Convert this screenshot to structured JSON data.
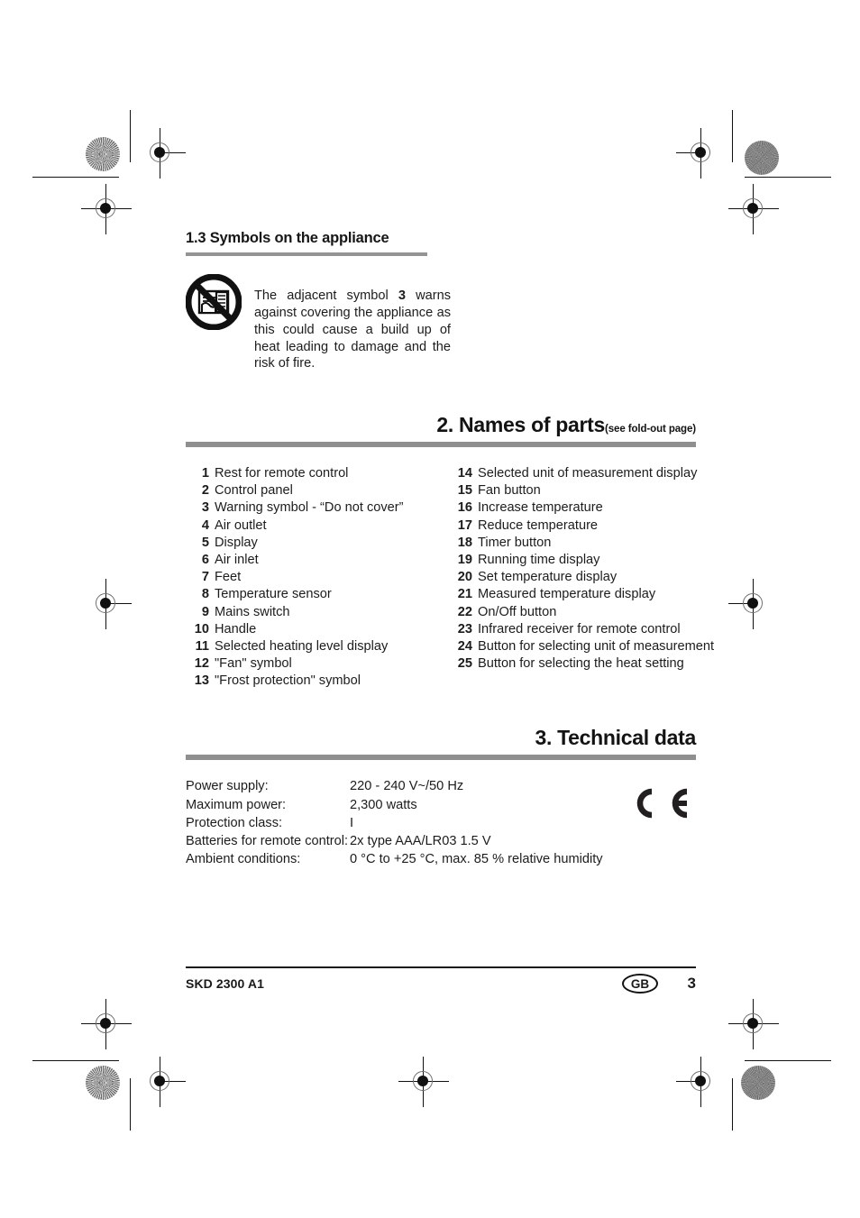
{
  "section_symbols": {
    "heading": "1.3 Symbols on the appliance",
    "icon": "do-not-cover-prohibition-icon",
    "paragraph_pre": "The adjacent symbol ",
    "paragraph_bold": "3",
    "paragraph_post": " warns against covering the appliance as this could cause a build up of heat leading to damage and the risk of fire."
  },
  "section_parts": {
    "heading": "2. Names of parts",
    "heading_note": "(see fold-out page)",
    "left_column": [
      {
        "num": "1",
        "label": "Rest for remote control"
      },
      {
        "num": "2",
        "label": "Control panel"
      },
      {
        "num": "3",
        "label": "Warning symbol - “Do not cover”"
      },
      {
        "num": "4",
        "label": "Air outlet"
      },
      {
        "num": "5",
        "label": "Display"
      },
      {
        "num": "6",
        "label": "Air inlet"
      },
      {
        "num": "7",
        "label": "Feet"
      },
      {
        "num": "8",
        "label": "Temperature sensor"
      },
      {
        "num": "9",
        "label": "Mains switch"
      },
      {
        "num": "10",
        "label": "Handle"
      },
      {
        "num": "11",
        "label": "Selected heating level display"
      },
      {
        "num": "12",
        "label": "\"Fan\" symbol"
      },
      {
        "num": "13",
        "label": "\"Frost protection\" symbol"
      }
    ],
    "right_column": [
      {
        "num": "14",
        "label": "Selected unit of measurement display"
      },
      {
        "num": "15",
        "label": "Fan button"
      },
      {
        "num": "16",
        "label": "Increase temperature"
      },
      {
        "num": "17",
        "label": "Reduce temperature"
      },
      {
        "num": "18",
        "label": "Timer button"
      },
      {
        "num": "19",
        "label": "Running time display"
      },
      {
        "num": "20",
        "label": "Set temperature display"
      },
      {
        "num": "21",
        "label": "Measured temperature display"
      },
      {
        "num": "22",
        "label": "On/Off button"
      },
      {
        "num": "23",
        "label": "Infrared receiver for remote control"
      },
      {
        "num": "24",
        "label": "Button for selecting unit of measurement"
      },
      {
        "num": "25",
        "label": "Button for selecting the heat setting"
      }
    ]
  },
  "section_technical": {
    "heading": "3. Technical data",
    "rows": [
      {
        "label": "Power supply:",
        "value": "220 - 240 V~/50 Hz"
      },
      {
        "label": "Maximum power:",
        "value": "2,300 watts"
      },
      {
        "label": "Protection class:",
        "value": "I"
      },
      {
        "label": "Batteries for remote control:",
        "value": "2x type AAA/LR03  1.5 V"
      },
      {
        "label": "Ambient conditions:",
        "value": "0 °C to +25 °C, max. 85 % relative humidity"
      }
    ],
    "ce_mark": "ce-conformity-mark"
  },
  "footer": {
    "model": "SKD 2300 A1",
    "language_badge": "GB",
    "page_number": "3"
  },
  "colors": {
    "rule_gray": "#8f8f8f",
    "text": "#1c1c1c",
    "footer_line": "#1a1a1a"
  }
}
